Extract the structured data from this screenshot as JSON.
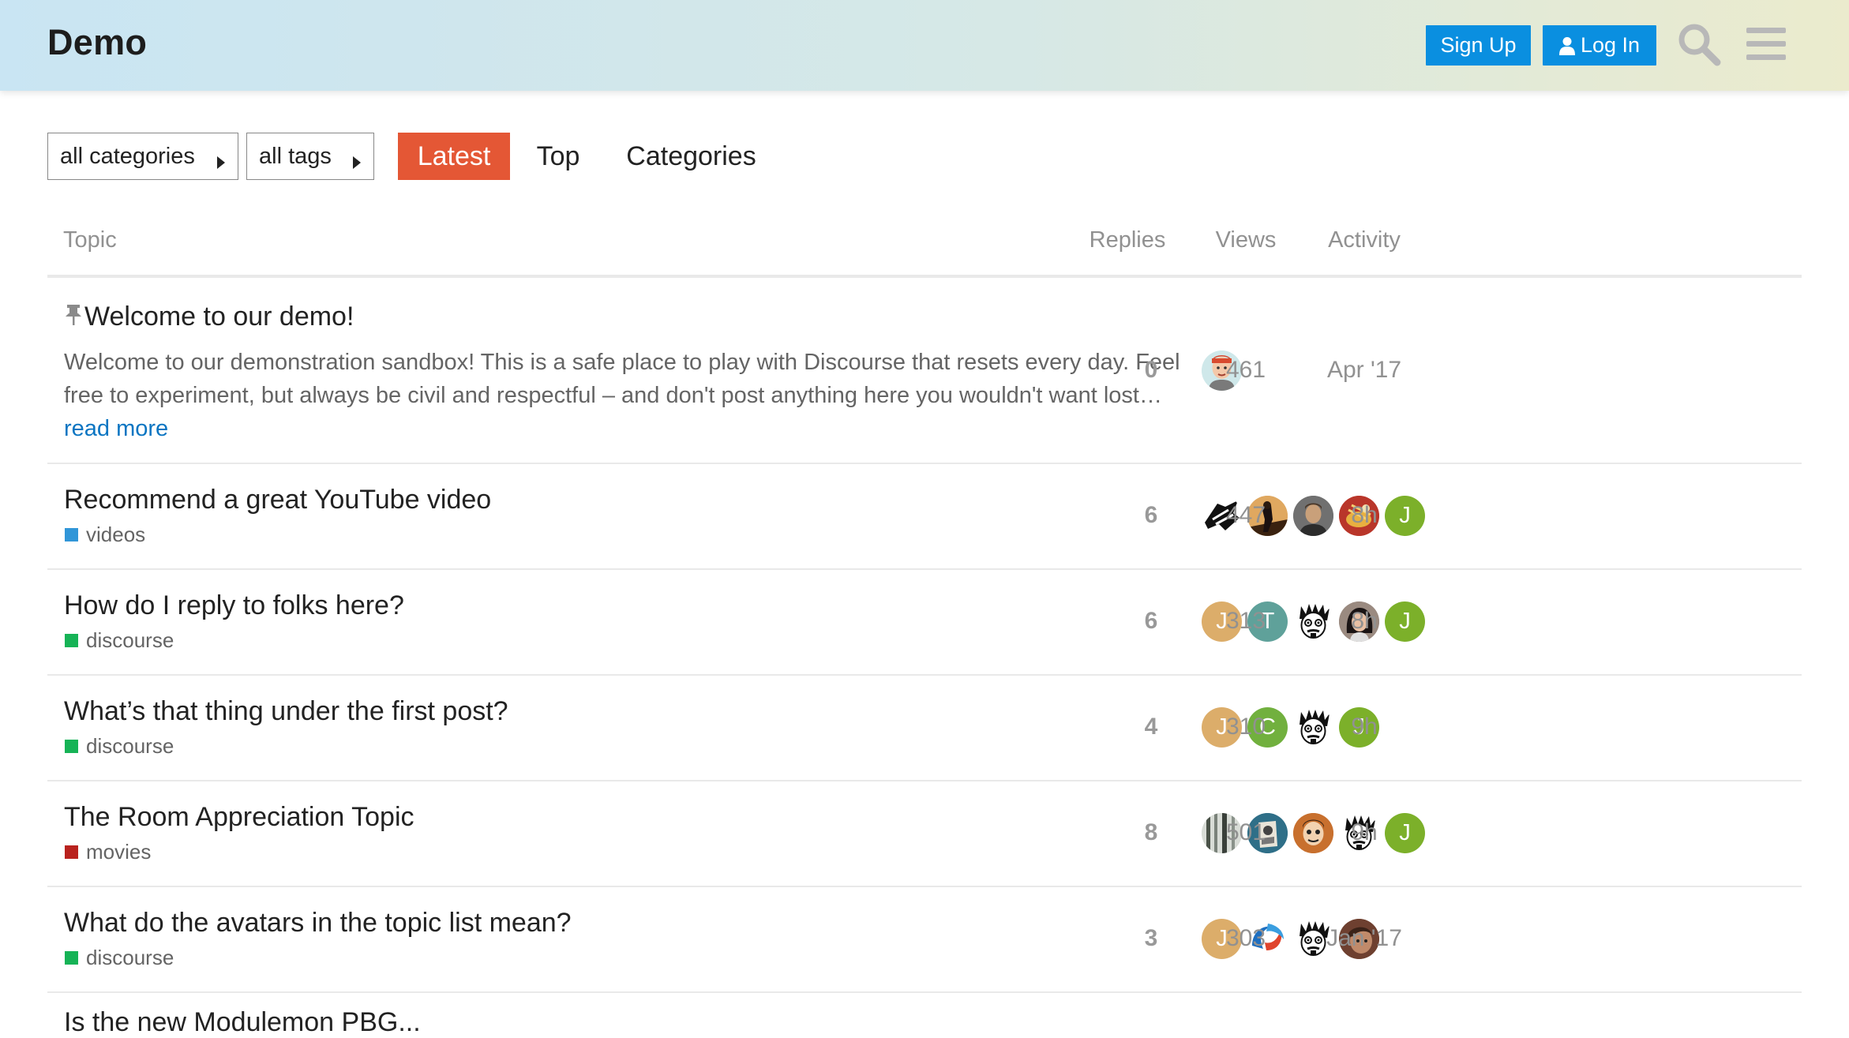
{
  "header": {
    "site_title": "Demo",
    "signup_label": "Sign Up",
    "login_label": "Log In",
    "gradient_colors": [
      "#c9e5f3",
      "#d6e8e6",
      "#ebebcd"
    ],
    "button_color": "#0a8fe0"
  },
  "nav": {
    "category_dropdown": "all categories",
    "tag_dropdown": "all tags",
    "tabs": [
      "Latest",
      "Top",
      "Categories"
    ],
    "active_tab": "Latest",
    "active_color": "#e45735"
  },
  "table": {
    "columns": {
      "topic": "Topic",
      "replies": "Replies",
      "views": "Views",
      "activity": "Activity"
    },
    "topics": [
      {
        "title": "Welcome to our demo!",
        "pinned": true,
        "excerpt": "Welcome to our demonstration sandbox! This is a safe place to play with Discourse that resets every day. Feel free to experiment, but always be civil and respectful – and don't post anything here you wouldn't want lost…",
        "read_more": "read more",
        "replies": "0",
        "views": "461",
        "activity": "Apr '17"
      },
      {
        "title": "Recommend a great YouTube video",
        "category": "videos",
        "category_color": "#3196d8",
        "replies": "6",
        "views": "447",
        "activity": "8h"
      },
      {
        "title": "How do I reply to folks here?",
        "category": "discourse",
        "category_color": "#16b356",
        "replies": "6",
        "views": "313",
        "activity": "8h"
      },
      {
        "title": "What’s that thing under the first post?",
        "category": "discourse",
        "category_color": "#16b356",
        "replies": "4",
        "views": "310",
        "activity": "9h"
      },
      {
        "title": "The Room Appreciation Topic",
        "category": "movies",
        "category_color": "#b9221e",
        "replies": "8",
        "views": "501",
        "activity": "9h"
      },
      {
        "title": "What do the avatars in the topic list mean?",
        "category": "discourse",
        "category_color": "#16b356",
        "replies": "3",
        "views": "303",
        "activity": "Jan '17"
      }
    ],
    "partial_next_title": "Is the new Modulemon PBG..."
  },
  "avatars": {
    "letters": {
      "j": "J",
      "t": "T",
      "c": "C"
    },
    "colors": {
      "tan": "#dcad6a",
      "green": "#7cb02a",
      "teal": "#5fa19a",
      "lime": "#71b03e"
    }
  }
}
